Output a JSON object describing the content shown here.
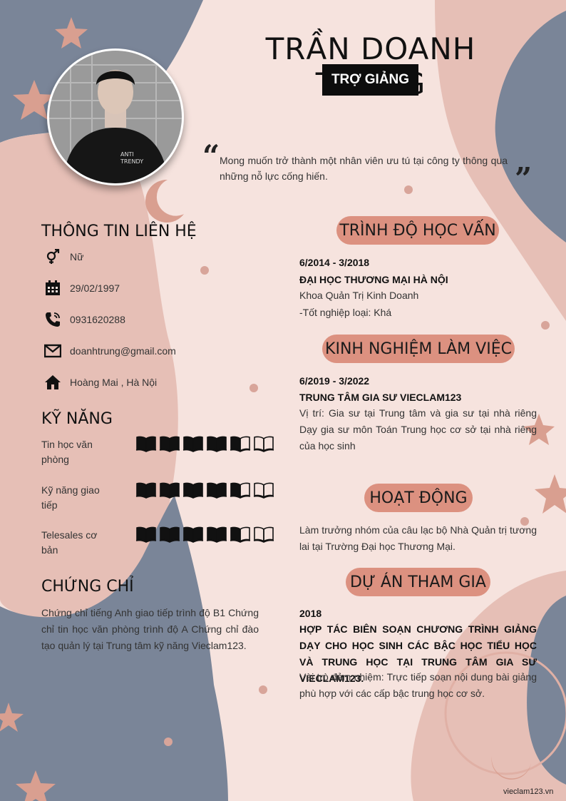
{
  "header": {
    "name": "TRẦN DOANH TRUNG",
    "role": "TRỢ GIẢNG",
    "quote": "Mong muốn trở thành một nhân viên ưu tú tại công ty thông qua những nỗ lực cống hiến."
  },
  "contact": {
    "title": "THÔNG TIN LIÊN HỆ",
    "items": [
      {
        "icon": "gender-icon",
        "value": "Nữ"
      },
      {
        "icon": "calendar-icon",
        "value": "29/02/1997"
      },
      {
        "icon": "phone-icon",
        "value": "0931620288"
      },
      {
        "icon": "email-icon",
        "value": "doanhtrung@gmail.com"
      },
      {
        "icon": "home-icon",
        "value": "Hoàng Mai , Hà Nội"
      }
    ]
  },
  "skills": {
    "title": "KỸ NĂNG",
    "items": [
      {
        "label": "Tin học văn phòng",
        "rating": 4,
        "max": 6
      },
      {
        "label": "Kỹ năng giao tiếp",
        "rating": 4,
        "max": 6
      },
      {
        "label": "Telesales cơ bản",
        "rating": 4,
        "max": 6
      }
    ]
  },
  "certificates": {
    "title": "CHỨNG CHỈ",
    "text": "Chứng chỉ tiếng Anh giao tiếp trình độ B1 Chứng chỉ tin học văn phòng trình độ A Chứng chỉ đào tạo quản lý tại Trung tâm kỹ năng Vieclam123."
  },
  "education": {
    "title": "TRÌNH ĐỘ HỌC VẤN",
    "period": "6/2014 - 3/2018",
    "school": "ĐẠI HỌC THƯƠNG MẠI HÀ NỘI",
    "major": "Khoa Quản Trị Kinh Doanh",
    "grade": "-Tốt nghiệp loại: Khá"
  },
  "experience": {
    "title": "KINH NGHIỆM LÀM VIỆC",
    "period": "6/2019 - 3/2022",
    "company": "TRUNG TÂM GIA SƯ VIECLAM123",
    "description": "Vị trí: Gia sư tại Trung tâm và gia sư tại nhà riêng Dạy gia sư môn Toán Trung học cơ sở tại nhà riêng của học sinh"
  },
  "activities": {
    "title": "HOẠT ĐỘNG",
    "text": "Làm trưởng nhóm của câu lạc bộ Nhà Quản trị tương lai tại Trường Đại học Thương Mại."
  },
  "projects": {
    "title": "DỰ ÁN THAM GIA",
    "year": "2018",
    "name": "HỢP TÁC BIÊN SOẠN CHƯƠNG TRÌNH GIẢNG DẠY CHO HỌC SINH CÁC BẬC HỌC TIỂU HỌC VÀ TRUNG HỌC TẠI TRUNG TÂM GIA SƯ VIECLAM123.",
    "description": "Vài trò đảm nhiệm: Trực tiếp soạn nội dung bài giảng phù hợp với các cấp bậc trung học cơ sở."
  },
  "footer": {
    "brand": "vieclam123.vn"
  },
  "colors": {
    "background": "#f6e3de",
    "blob_pink": "#e6bfb6",
    "blob_blue": "#7a8598",
    "accent": "#dc9180",
    "dark": "#0d0d0d"
  }
}
